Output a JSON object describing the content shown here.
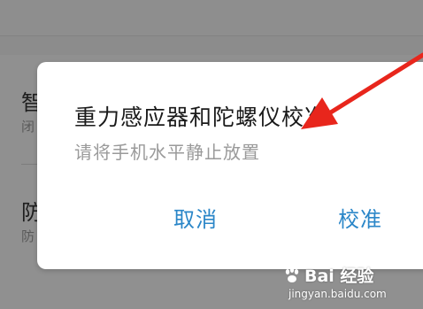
{
  "background": {
    "rows": [
      {
        "title": "智",
        "subtitle": "闭"
      },
      {
        "title": "防",
        "subtitle": "防"
      }
    ]
  },
  "dialog": {
    "title": "重力感应器和陀螺仪校准",
    "message": "请将手机水平静止放置",
    "cancel_label": "取消",
    "confirm_label": "校准"
  },
  "watermark": {
    "brand": "Bai 经验",
    "url": "jingyan.baidu.com"
  },
  "colors": {
    "button_text": "#2a86c8",
    "arrow": "#e8261c",
    "dim_overlay": "#8c8c8c"
  }
}
